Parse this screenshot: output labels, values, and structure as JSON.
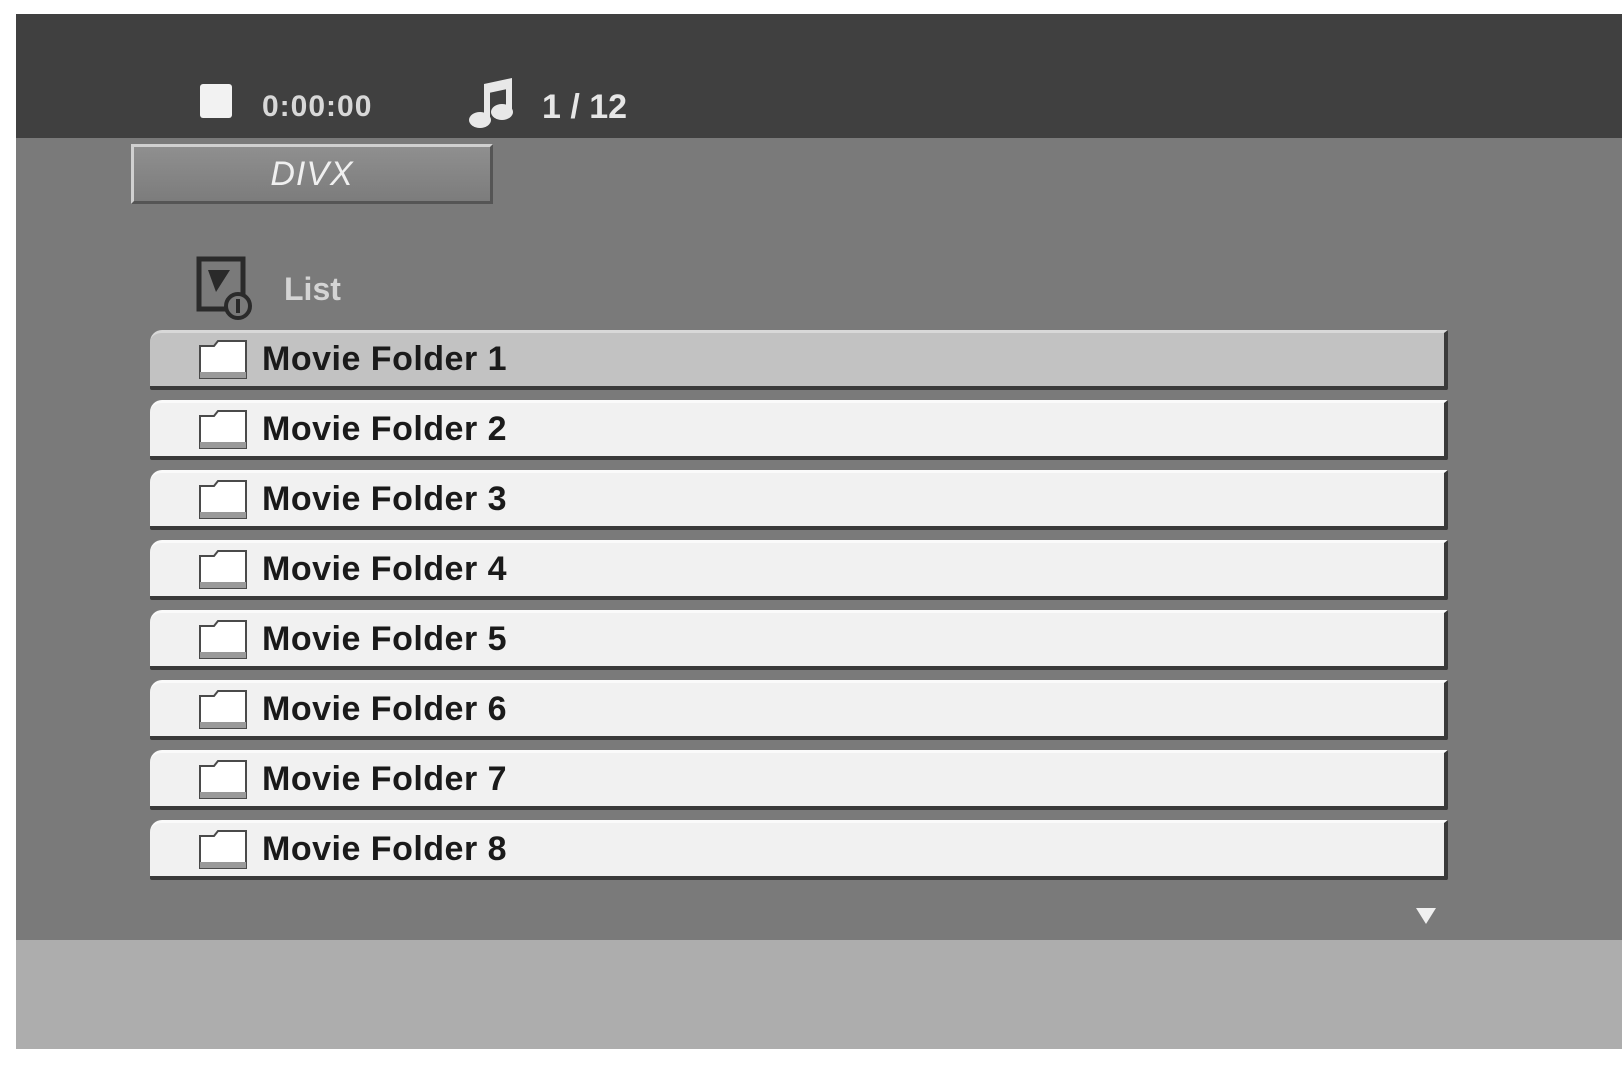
{
  "status": {
    "time": "0:00:00",
    "track": "1 / 12"
  },
  "tab": {
    "label": "DIVX"
  },
  "list": {
    "header_label": "List",
    "items": [
      {
        "label": "Movie Folder 1",
        "selected": true
      },
      {
        "label": "Movie Folder 2",
        "selected": false
      },
      {
        "label": "Movie Folder 3",
        "selected": false
      },
      {
        "label": "Movie Folder 4",
        "selected": false
      },
      {
        "label": "Movie Folder 5",
        "selected": false
      },
      {
        "label": "Movie Folder 6",
        "selected": false
      },
      {
        "label": "Movie Folder 7",
        "selected": false
      },
      {
        "label": "Movie Folder 8",
        "selected": false
      }
    ]
  },
  "icons": {
    "stop": "stop-icon",
    "music": "music-note-icon",
    "list": "list-icon",
    "folder": "folder-icon",
    "scroll": "scroll-down-icon"
  },
  "colors": {
    "topbar": "#404040",
    "panel": "#7a7a7a",
    "row": "#f1f1f1",
    "row_selected": "#c2c2c2",
    "bottom_band": "#adadad"
  }
}
